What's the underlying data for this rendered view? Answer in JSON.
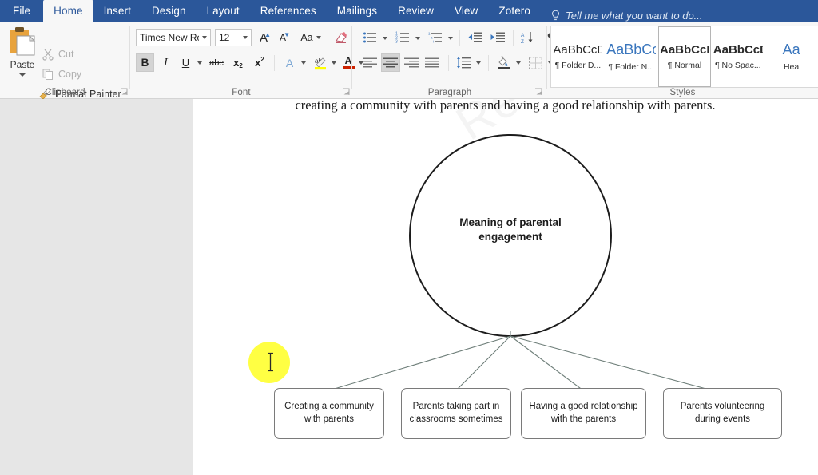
{
  "window": {
    "accent_color": "#2b579a",
    "tabs": [
      {
        "label": "File",
        "active": false
      },
      {
        "label": "Home",
        "active": true
      },
      {
        "label": "Insert",
        "active": false
      },
      {
        "label": "Design",
        "active": false
      },
      {
        "label": "Layout",
        "active": false
      },
      {
        "label": "References",
        "active": false
      },
      {
        "label": "Mailings",
        "active": false
      },
      {
        "label": "Review",
        "active": false
      },
      {
        "label": "View",
        "active": false
      },
      {
        "label": "Zotero",
        "active": false
      }
    ],
    "tell_me": "Tell me what you want to do..."
  },
  "ribbon": {
    "clipboard": {
      "group_label": "Clipboard",
      "paste_label": "Paste",
      "cut_label": "Cut",
      "copy_label": "Copy",
      "format_painter_label": "Format Painter"
    },
    "font": {
      "group_label": "Font",
      "font_name": "Times New Ro",
      "font_size": "12",
      "bold_label": "B",
      "italic_label": "I",
      "underline_label": "U",
      "strikethrough_label": "abc",
      "subscript_label": "x",
      "subscript_sub": "2",
      "superscript_label": "x",
      "superscript_sup": "2",
      "grow_font_label": "A",
      "shrink_font_label": "A",
      "change_case_label": "Aa",
      "text_effects_label": "A",
      "highlight_label": "ab",
      "font_color_label": "A",
      "bold_active": true
    },
    "paragraph": {
      "group_label": "Paragraph",
      "center_active": true
    },
    "styles": {
      "group_label": "Styles",
      "items": [
        {
          "preview": "AaBbCcDc",
          "name": "Folder D...",
          "style": "plain",
          "selected": false
        },
        {
          "preview": "AaBbCc",
          "name": "Folder N...",
          "style": "blue",
          "selected": false
        },
        {
          "preview": "AaBbCcDc",
          "name": "Normal",
          "style": "bold",
          "selected": true
        },
        {
          "preview": "AaBbCcDc",
          "name": "No Spac...",
          "style": "bold",
          "selected": false
        },
        {
          "preview": "Aa",
          "name": "Hea",
          "style": "blue",
          "selected": false
        }
      ]
    }
  },
  "document": {
    "visible_text_line": "creating a community with parents and having a good relationship with parents.",
    "watermark": "Re"
  },
  "diagram": {
    "type": "hierarchy",
    "root": {
      "shape": "circle",
      "label_line1": "Meaning of parental",
      "label_line2": "engagement"
    },
    "children": [
      {
        "label": "Creating a community with parents"
      },
      {
        "label": "Parents taking part in classrooms sometimes"
      },
      {
        "label": "Having a good relationship with the parents"
      },
      {
        "label": "Parents volunteering during events"
      }
    ]
  },
  "cursor": {
    "type": "i-beam",
    "highlight_color": "#ffff33"
  }
}
